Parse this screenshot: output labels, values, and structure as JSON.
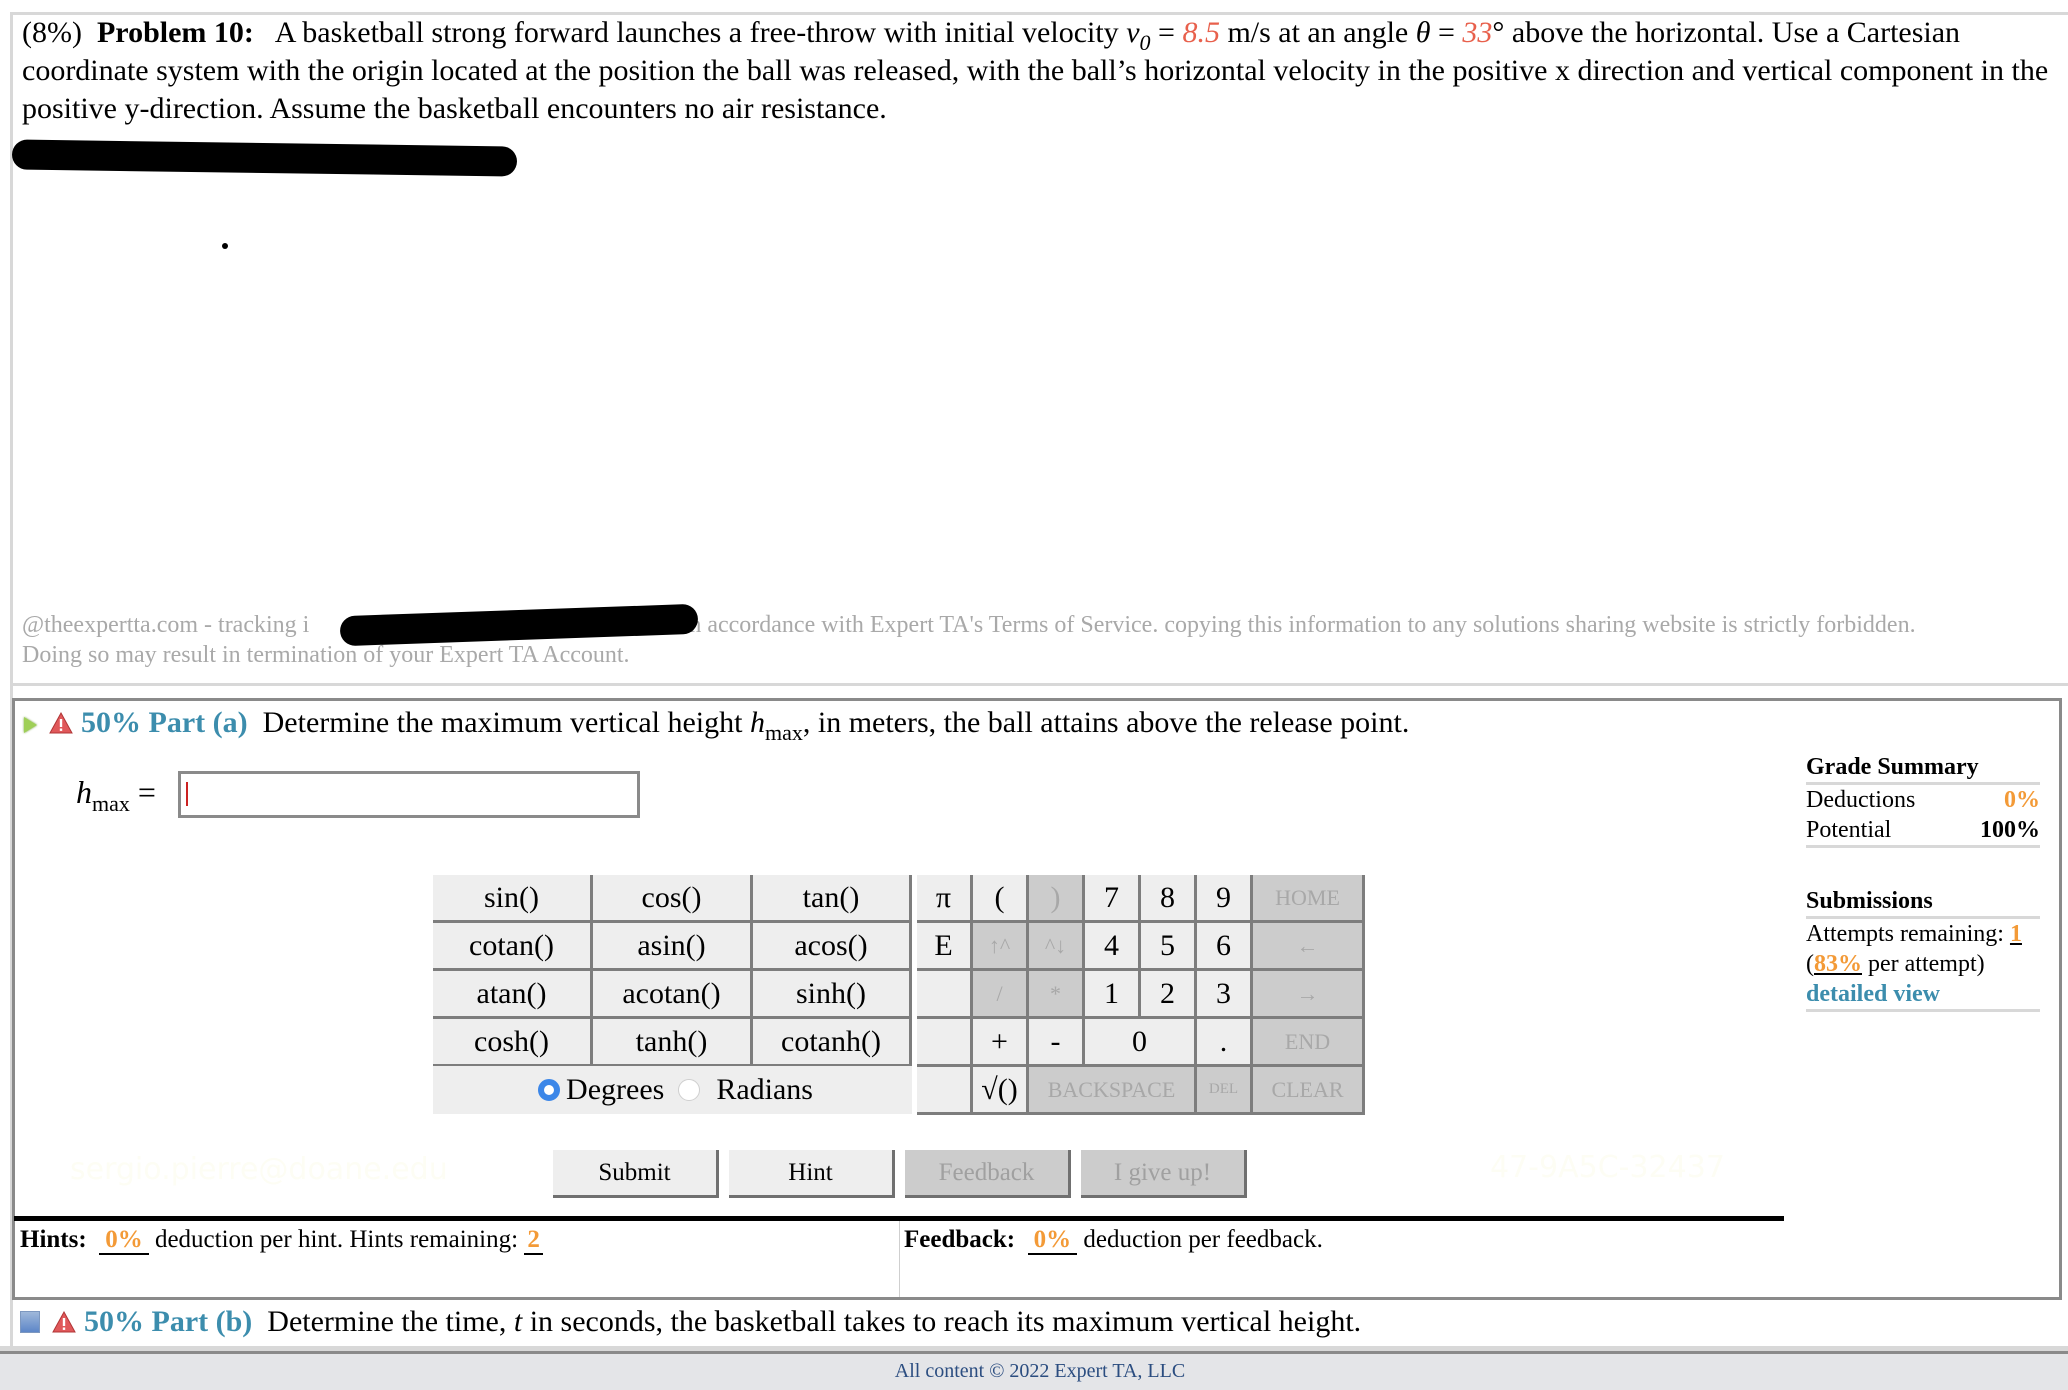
{
  "problem": {
    "weight": "(8%)",
    "label": "Problem 10:",
    "text_1": "A basketball strong forward launches a free-throw with initial velocity ",
    "v0_symbol": "v",
    "v0_sub": "0",
    "eq": " = ",
    "v0_value": "8.5",
    "text_2": " m/s at an angle ",
    "theta_symbol": "θ",
    "theta_value": "33",
    "text_3": "° above the horizontal. Use a Cartesian coordinate system with the origin located at the position the ball was released, with the ball’s horizontal velocity in the positive x direction and vertical component in the positive y-direction. Assume the basketball encounters no air resistance."
  },
  "tracking": {
    "prefix": "@theexpertta.com - tracking i",
    "suffix": ". In accordance with Expert TA's Terms of Service. copying this information to any solutions sharing website is strictly forbidden.",
    "line2": "Doing so may result in termination of your Expert TA Account."
  },
  "part_a": {
    "weight": "50%",
    "label": "Part (a)",
    "question_1": "Determine the maximum vertical height ",
    "symbol": "h",
    "symbol_sub": "max",
    "question_2": ", in meters, the ball attains above the release point.",
    "input_label_symbol": "h",
    "input_label_sub": "max",
    "input_eq": " = ",
    "input_value": ""
  },
  "keypad": {
    "functions": [
      "sin()",
      "cos()",
      "tan()",
      "cotan()",
      "asin()",
      "acos()",
      "atan()",
      "acotan()",
      "sinh()",
      "cosh()",
      "tanh()",
      "cotanh()"
    ],
    "angle_modes": [
      "Degrees",
      "Radians"
    ],
    "angle_selected": "Degrees",
    "keys": {
      "pi": "π",
      "e": "E",
      "lparen": "(",
      "rparen": ")",
      "up": "↑^",
      "down": "^↓",
      "div": "/",
      "mul": "*",
      "plus": "+",
      "minus": "-",
      "sqrt": "√()",
      "backspace": "BACKSPACE",
      "del": "DEL",
      "home": "HOME",
      "left": "←",
      "right": "→",
      "end": "END",
      "clear": "CLEAR",
      "d7": "7",
      "d8": "8",
      "d9": "9",
      "d4": "4",
      "d5": "5",
      "d6": "6",
      "d1": "1",
      "d2": "2",
      "d3": "3",
      "d0": "0",
      "dot": "."
    }
  },
  "actions": {
    "submit": "Submit",
    "hint": "Hint",
    "feedback": "Feedback",
    "give_up": "I give up!"
  },
  "watermarks": {
    "email": "sergio.pierre@doane.edu",
    "code": "47-9A5C-32437"
  },
  "hints": {
    "label": "Hints:",
    "deduction": "0%",
    "text": " deduction per hint. Hints remaining: ",
    "remaining": "2"
  },
  "feedback": {
    "label": "Feedback:",
    "deduction": "0%",
    "text": " deduction per feedback."
  },
  "grade_summary": {
    "title": "Grade Summary",
    "deductions_label": "Deductions",
    "deductions_value": "0%",
    "potential_label": "Potential",
    "potential_value": "100%"
  },
  "submissions": {
    "title": "Submissions",
    "attempts_label": "Attempts remaining: ",
    "attempts_value": "1",
    "per_attempt_open": "(",
    "per_attempt_value": "83%",
    "per_attempt_text": " per attempt)",
    "detailed_view": "detailed view"
  },
  "part_b": {
    "weight": "50%",
    "label": "Part (b)",
    "question_1": "Determine the time, ",
    "symbol": "t",
    "question_2": " in seconds, the basketball takes to reach its maximum vertical height."
  },
  "footer": {
    "text": "All content © 2022 Expert TA, LLC"
  },
  "colors": {
    "given_value": "#e8604c",
    "part_label": "#3c8dad",
    "deduction_orange": "#f39a37",
    "radio_selected": "#3b86e8"
  }
}
